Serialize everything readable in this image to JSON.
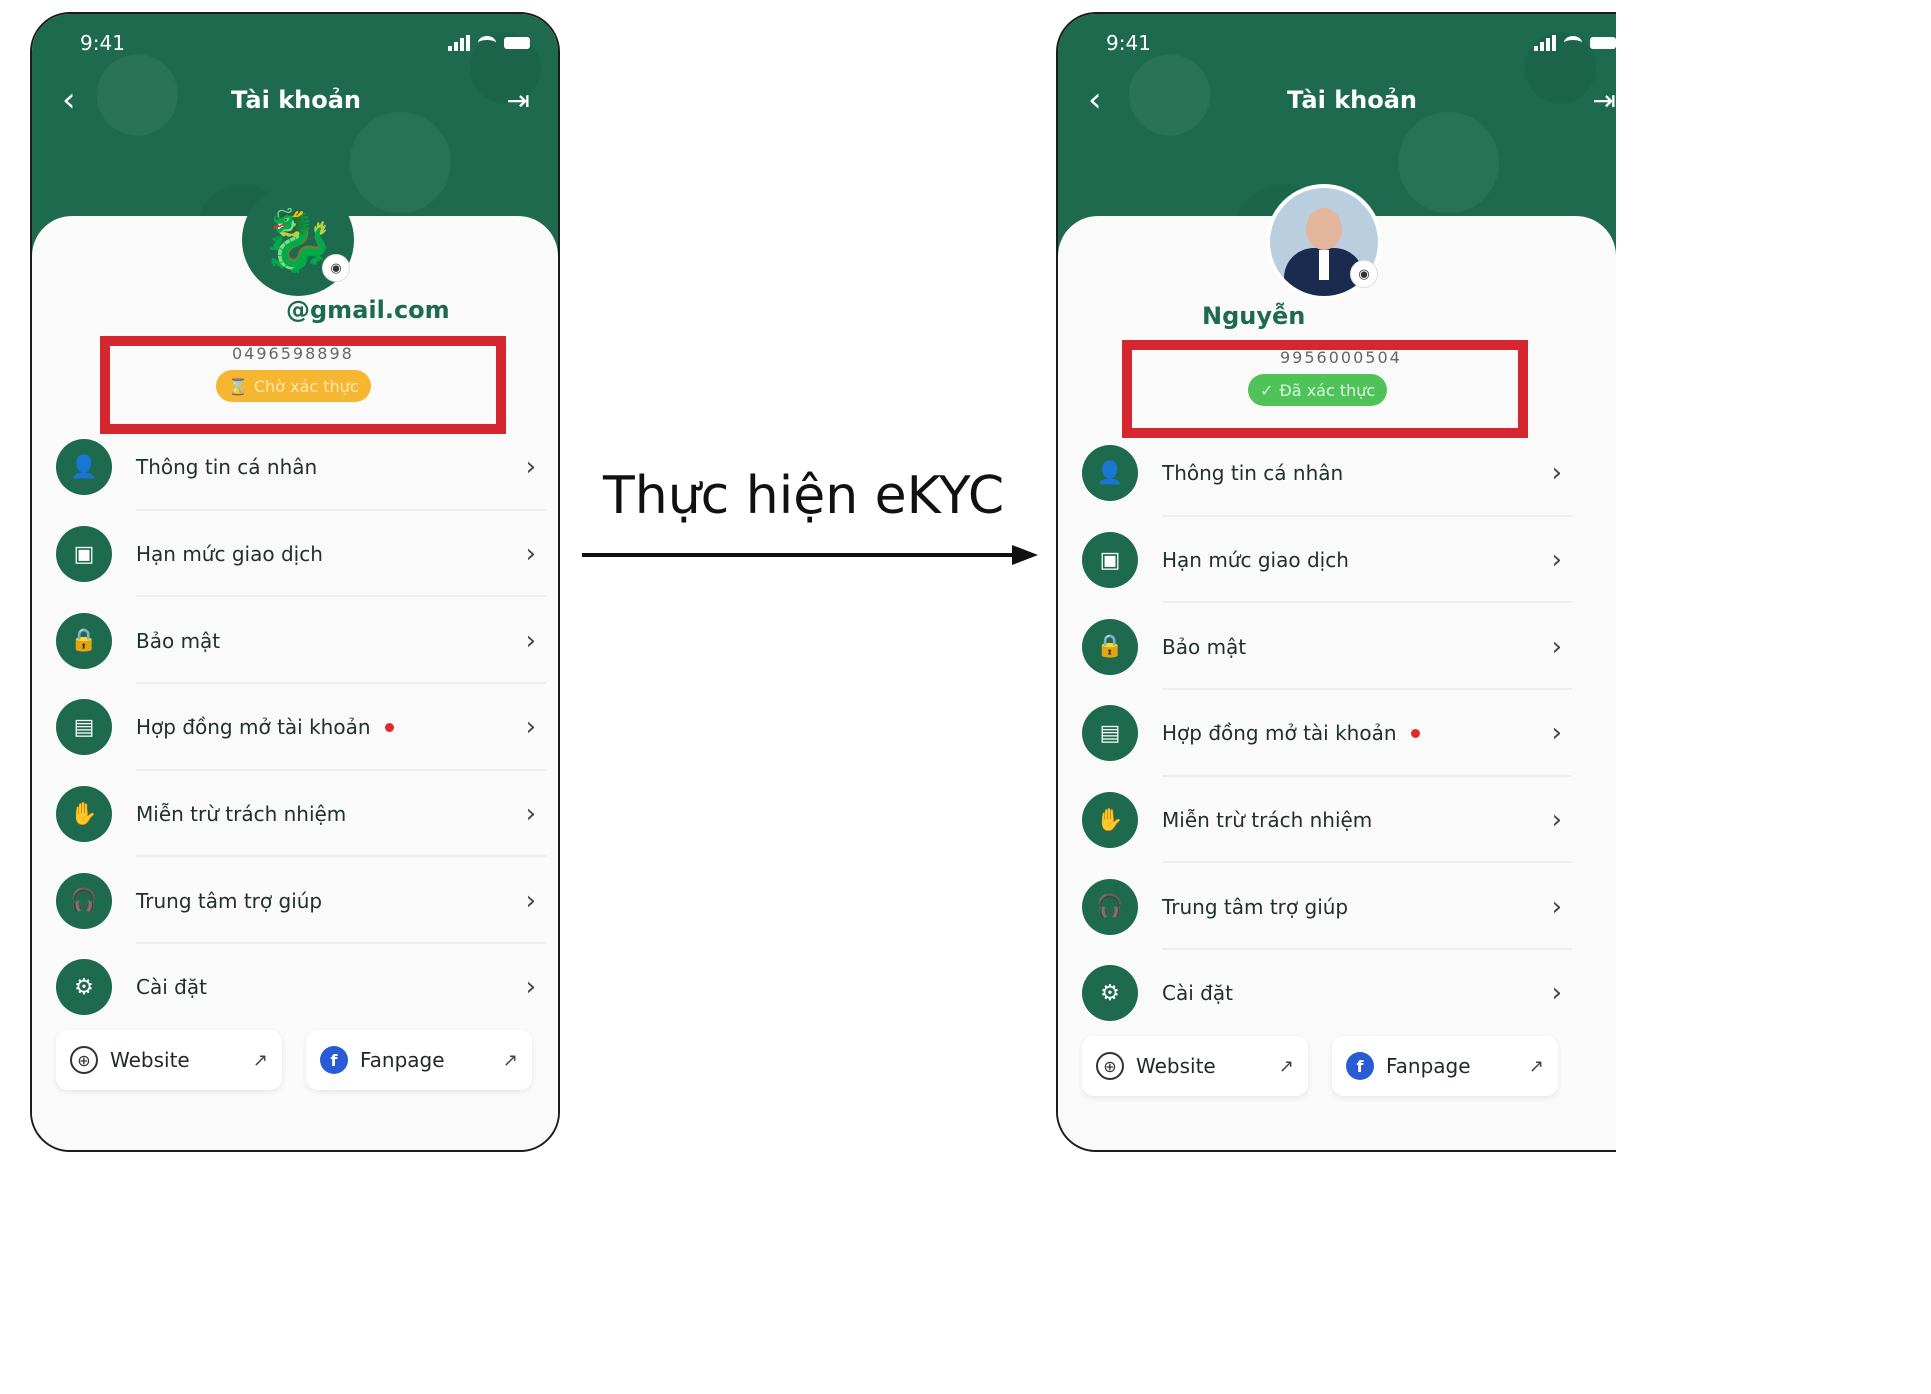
{
  "transition": {
    "label": "Thực hiện eKYC"
  },
  "left": {
    "status_time": "9:41",
    "title": "Tài khoản",
    "email": "@gmail.com",
    "phone_number": "0496598898",
    "badge_icon": "hourglass-icon",
    "badge_text": "Chờ xác thực",
    "badge_color": "#f5b731"
  },
  "right": {
    "status_time": "9:41",
    "title": "Tài khoản",
    "name": "Nguyễn",
    "phone_number": "9956000504",
    "badge_icon": "check-circle-icon",
    "badge_text": "Đã xác thực",
    "badge_color": "#4fc35a"
  },
  "menu": [
    {
      "label": "Thông tin cá nhân",
      "icon": "user-icon"
    },
    {
      "label": "Hạn mức giao dịch",
      "icon": "money-icon"
    },
    {
      "label": "Bảo mật",
      "icon": "lock-icon"
    },
    {
      "label": "Hợp đồng mở tài khoản",
      "icon": "document-icon",
      "dot": true
    },
    {
      "label": "Miễn trừ trách nhiệm",
      "icon": "hand-icon"
    },
    {
      "label": "Trung tâm trợ giúp",
      "icon": "headset-icon"
    },
    {
      "label": "Cài đặt",
      "icon": "gear-icon"
    }
  ],
  "links": {
    "website": "Website",
    "fanpage": "Fanpage"
  },
  "colors": {
    "brand_green": "#1d6a4e",
    "highlight_red": "#d62630",
    "notification_dot": "#e02b2b"
  }
}
